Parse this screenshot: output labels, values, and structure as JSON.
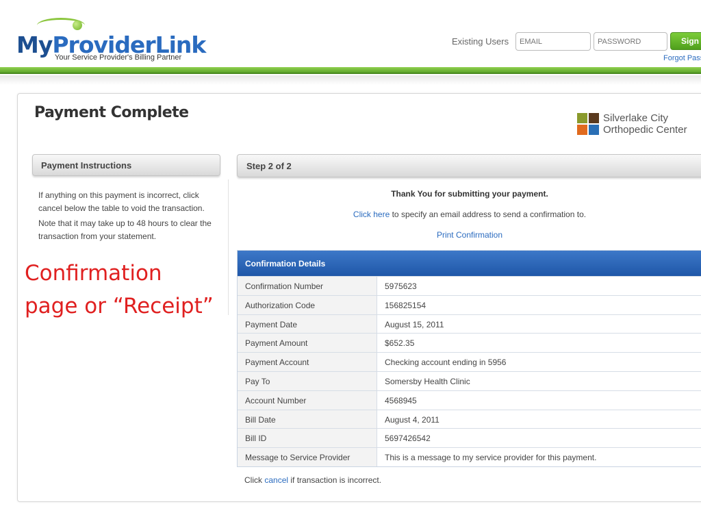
{
  "header": {
    "logo": {
      "part_my": "My",
      "part_provider": "Provider",
      "part_link": "Link",
      "tagline": "Your Service Provider's Billing Partner"
    },
    "existing_users_label": "Existing Users",
    "email_placeholder": "EMAIL",
    "password_placeholder": "PASSWORD",
    "sign_in_label": "Sign In",
    "forgot_password_label": "Forgot Password?"
  },
  "page": {
    "title": "Payment Complete",
    "clinic_logo": {
      "line1": "Silverlake City",
      "line2": "Orthopedic Center"
    }
  },
  "sidebar": {
    "header": "Payment Instructions",
    "paragraphs": [
      "If anything on this payment is incorrect, click cancel below the table to void the transaction.",
      "Note that it may take up to 48 hours to clear the transaction from your statement."
    ]
  },
  "annotation": {
    "line1": "Confirmation",
    "line2": "page or “Receipt”"
  },
  "main": {
    "step_label": "Step 2 of 2",
    "thank_you": "Thank You for submitting your payment.",
    "click_here_link": "Click here",
    "email_text": " to specify an email address to send a confirmation to.",
    "print_confirmation": "Print Confirmation",
    "details": {
      "title": "Confirmation Details",
      "rows": [
        {
          "label": "Confirmation Number",
          "value": "5975623"
        },
        {
          "label": "Authorization Code",
          "value": "156825154"
        },
        {
          "label": "Payment Date",
          "value": "August 15, 2011"
        },
        {
          "label": "Payment Amount",
          "value": "$652.35"
        },
        {
          "label": "Payment Account",
          "value": "Checking account ending in 5956"
        },
        {
          "label": "Pay To",
          "value": "Somersby Health Clinic"
        },
        {
          "label": "Account Number",
          "value": "4568945"
        },
        {
          "label": "Bill Date",
          "value": "August 4, 2011"
        },
        {
          "label": "Bill ID",
          "value": "5697426542"
        },
        {
          "label": "Message to Service Provider",
          "value": "This is a message to my service provider for this payment."
        }
      ]
    },
    "cancel": {
      "prefix": "Click ",
      "link": "cancel",
      "suffix": " if transaction is incorrect."
    }
  },
  "colors": {
    "brand_green": "#5da52b",
    "brand_blue": "#2a6bbf",
    "annotation_red": "#e02020"
  }
}
